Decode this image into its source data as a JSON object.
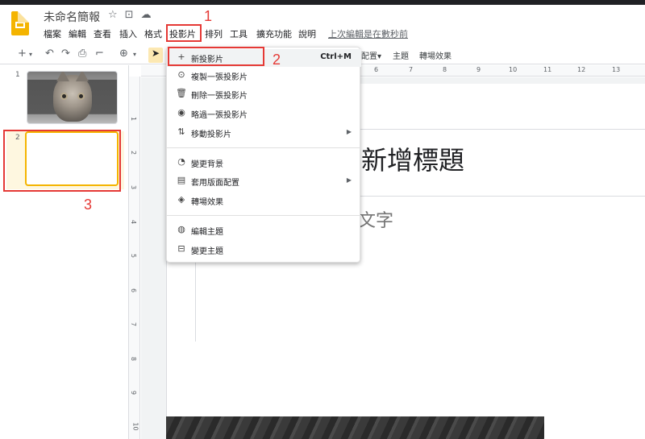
{
  "doc": {
    "title": "未命名簡報",
    "icons": [
      "star-icon",
      "folder-icon",
      "cloud-icon"
    ]
  },
  "menubar": {
    "items": [
      "檔案",
      "編輯",
      "查看",
      "插入",
      "格式",
      "投影片",
      "排列",
      "工具",
      "擴充功能",
      "說明"
    ],
    "last_edit": "上次編輯是在數秒前"
  },
  "toolbar": {
    "layout_label": "配置▾",
    "theme_label": "主題",
    "transition_label": "轉場效果"
  },
  "annotations": {
    "a1": "1",
    "a2": "2",
    "a3": "3"
  },
  "filmstrip": {
    "slide1_num": "1",
    "slide2_num": "2"
  },
  "ruler": {
    "top": [
      "6",
      "7",
      "8",
      "9",
      "10",
      "11",
      "12",
      "13"
    ],
    "left": [
      "1",
      "2",
      "3",
      "4",
      "5",
      "6",
      "7",
      "8",
      "9",
      "10"
    ]
  },
  "slide": {
    "title_placeholder": "新增標題",
    "subtitle_placeholder": "文字"
  },
  "menu": {
    "new_slide": "新投影片",
    "new_slide_shortcut": "Ctrl+M",
    "duplicate": "複製一張投影片",
    "delete": "刪除一張投影片",
    "skip": "略過一張投影片",
    "move": "移動投影片",
    "change_bg": "變更背景",
    "apply_layout": "套用版面配置",
    "transition": "轉場效果",
    "edit_theme": "編輯主題",
    "change_theme": "變更主題"
  },
  "colors": {
    "accent": "#f4b400",
    "annotation": "#e53935",
    "highlight": "#fef7e0"
  }
}
